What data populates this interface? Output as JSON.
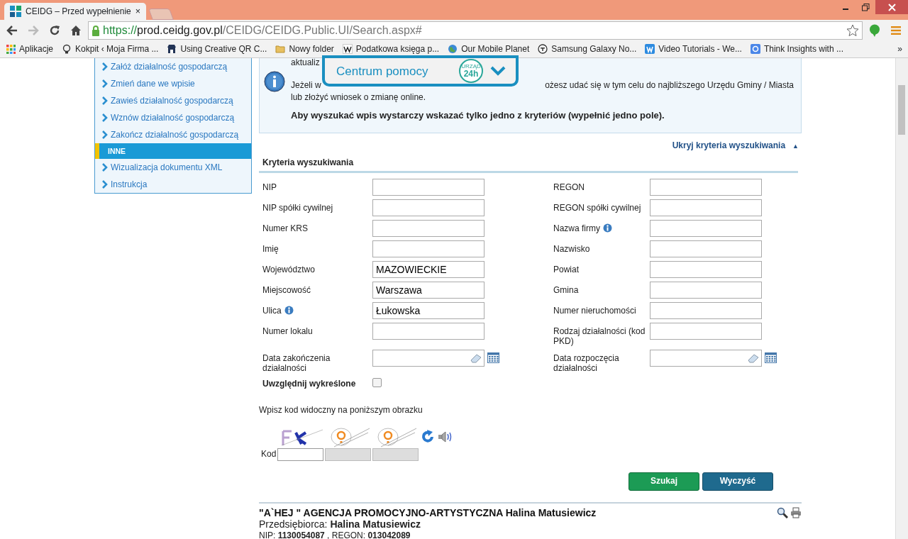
{
  "browser": {
    "tab_title": "CEIDG – Przed wypełnienie",
    "tab_close": "×",
    "url": {
      "scheme": "https://",
      "host": "prod.ceidg.gov.pl",
      "path": "/CEIDG/CEIDG.Public.UI/Search.aspx#"
    },
    "forward_disabled": true,
    "bookmarks": [
      {
        "label": "Aplikacje",
        "kind": "apps"
      },
      {
        "label": "Kokpit ‹ Moja Firma ...",
        "kind": "bulb"
      },
      {
        "label": "Using Creative QR C...",
        "kind": "store"
      },
      {
        "label": "Nowy folder",
        "kind": "folder"
      },
      {
        "label": "Podatkowa księga p...",
        "kind": "wiki"
      },
      {
        "label": "Our Mobile Planet",
        "kind": "globe"
      },
      {
        "label": "Samsung Galaxy No...",
        "kind": "t2"
      },
      {
        "label": "Video Tutorials - We...",
        "kind": "w"
      },
      {
        "label": "Think Insights with ...",
        "kind": "g"
      }
    ],
    "bookmarks_more": "»"
  },
  "sidebar": {
    "items": [
      {
        "label": "Załóż działalność gospodarczą",
        "kind": "link"
      },
      {
        "label": "Zmień dane we wpisie",
        "kind": "link"
      },
      {
        "label": "Zawieś działalność gospodarczą",
        "kind": "link"
      },
      {
        "label": "Wznów działalność gospodarczą",
        "kind": "link"
      },
      {
        "label": "Zakończ działalność gospodarczą",
        "kind": "link"
      },
      {
        "label": "INNE",
        "kind": "header"
      },
      {
        "label": "Wizualizacja dokumentu XML",
        "kind": "link"
      },
      {
        "label": "Instrukcja",
        "kind": "link"
      }
    ]
  },
  "info": {
    "top_line": "aktualiz",
    "line1_start": "Jeżeli w",
    "line1_end": "ożesz udać się w tym celu do najbliższego Urzędu Gminy / Miasta",
    "line2": "lub złożyć wniosek o zmianę online.",
    "notice": "Aby wyszukać wpis wystarczy wskazać tylko jedno z kryteriów (wypełnić jedno pole)."
  },
  "help_overlay": {
    "title": "Centrum pomocy",
    "badge_top": "URZĄD",
    "badge_main": "24h"
  },
  "criteria": {
    "toggle": "Ukryj kryteria wyszukiwania",
    "toggle_arrow": "▲",
    "title": "Kryteria wyszukiwania",
    "fields": [
      {
        "label": "NIP",
        "kind": "text"
      },
      {
        "label": "REGON",
        "kind": "text"
      },
      {
        "label": "NIP spółki cywilnej",
        "kind": "text"
      },
      {
        "label": "REGON spółki cywilnej",
        "kind": "text"
      },
      {
        "label": "Numer KRS",
        "kind": "text"
      },
      {
        "label": "Nazwa firmy",
        "kind": "text",
        "info": true
      },
      {
        "label": "Imię",
        "kind": "text"
      },
      {
        "label": "Nazwisko",
        "kind": "text"
      },
      {
        "label": "Województwo",
        "kind": "text",
        "value": "MAZOWIECKIE"
      },
      {
        "label": "Powiat",
        "kind": "text"
      },
      {
        "label": "Miejscowość",
        "kind": "text",
        "value": "Warszawa"
      },
      {
        "label": "Gmina",
        "kind": "text"
      },
      {
        "label": "Ulica",
        "kind": "text",
        "info": true,
        "value": "Łukowska"
      },
      {
        "label": "Numer nieruchomości",
        "kind": "text"
      },
      {
        "label": "Numer lokalu",
        "kind": "text"
      },
      {
        "label": "Rodzaj działalności (kod PKD)",
        "kind": "text"
      },
      {
        "label": "Data zakończenia działalności",
        "kind": "date"
      },
      {
        "label": "Data rozpoczęcia działalności",
        "kind": "date"
      }
    ],
    "include_deleted": {
      "label": "Uwzględnij wykreślone",
      "checked": false
    }
  },
  "captcha": {
    "prompt": "Wpisz kod widoczny na poniższym obrazku",
    "code_label": "Kod"
  },
  "buttons": [
    {
      "label": "Szukaj",
      "kind": "primary"
    },
    {
      "label": "Wyczyść",
      "kind": "secondary"
    }
  ],
  "results": [
    {
      "name": "\"A`HEJ \" AGENCJA PROMOCYJNO-ARTYSTYCZNA Halina Matusiewicz",
      "role": "Przedsiębiorca: **Halina Matusiewicz**",
      "ids": "NIP: **1130054087** , REGON: **013042089**"
    }
  ]
}
